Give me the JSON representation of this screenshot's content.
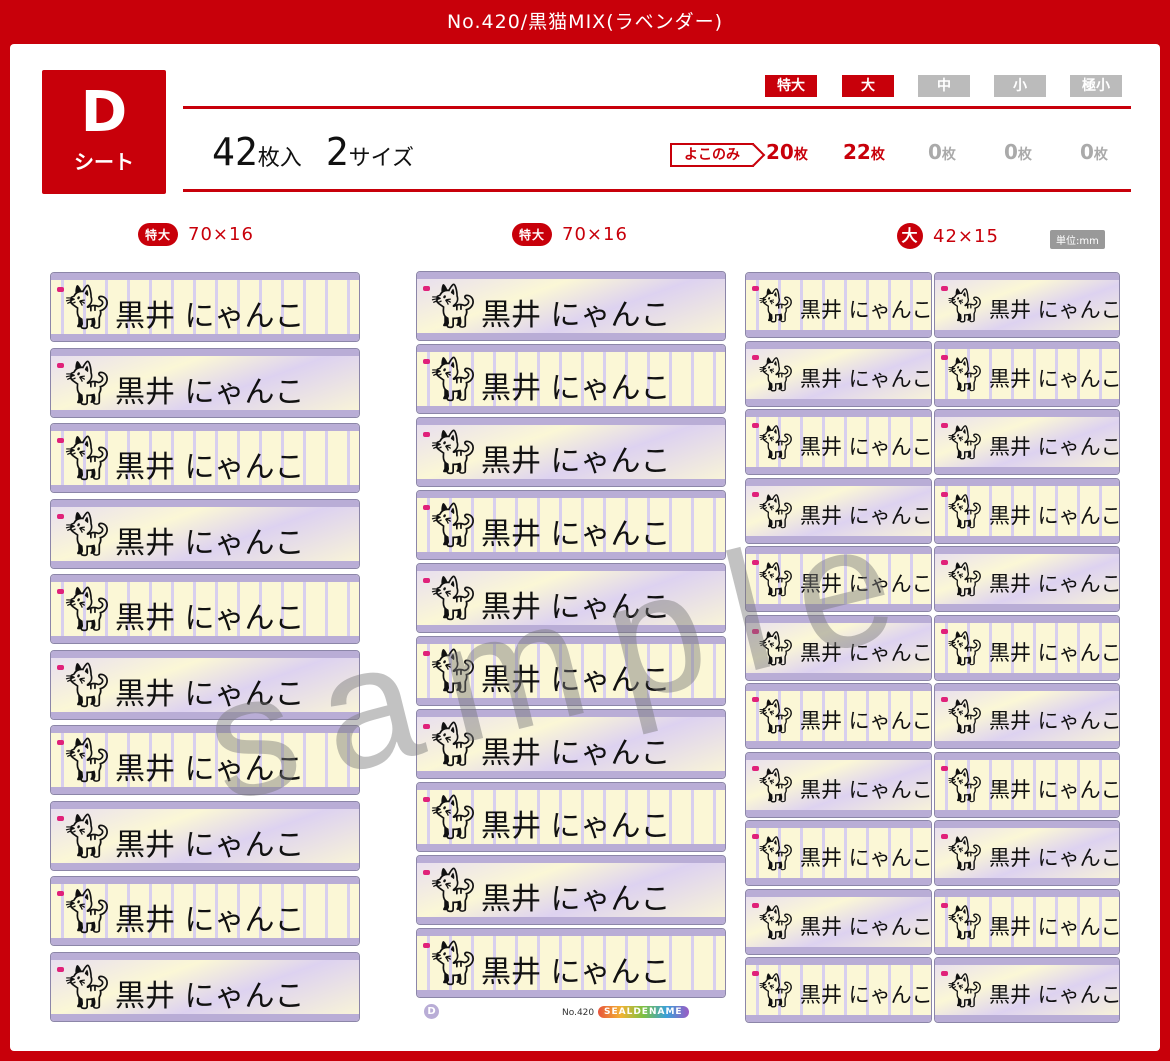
{
  "title": "No.420/黒猫MIX(ラベンダー)",
  "sheet": {
    "letter": "D",
    "word": "シート"
  },
  "count": {
    "num": "42",
    "unit": "枚入",
    "sizes_num": "2",
    "sizes_unit": "サイズ"
  },
  "size_tabs": [
    {
      "label": "特大",
      "active": true
    },
    {
      "label": "大",
      "active": true
    },
    {
      "label": "中",
      "active": false
    },
    {
      "label": "小",
      "active": false
    },
    {
      "label": "極小",
      "active": false
    }
  ],
  "yoko_label": "よこのみ",
  "counts": [
    {
      "num": "20",
      "unit": "枚"
    },
    {
      "num": "22",
      "unit": "枚"
    },
    {
      "num": "0",
      "unit": "枚"
    },
    {
      "num": "0",
      "unit": "枚"
    },
    {
      "num": "0",
      "unit": "枚"
    }
  ],
  "columns": [
    {
      "badge": "特大",
      "dims": "70×16"
    },
    {
      "badge": "特大",
      "dims": "70×16"
    },
    {
      "badge": "大",
      "dims": "42×15"
    }
  ],
  "unit_badge": "単位:mm",
  "label_name": "黒井 にゃんこ",
  "watermark": "sample",
  "footer": {
    "d": "D",
    "no": "No.420",
    "brand": "SEALDENAME"
  },
  "colors": {
    "brand_red": "#c8000a",
    "lavender": "#b9add6",
    "cream": "#fbf7d6",
    "bow": "#e0217a"
  },
  "icons": [
    "black-cat-icon",
    "pink-bow-icon"
  ]
}
